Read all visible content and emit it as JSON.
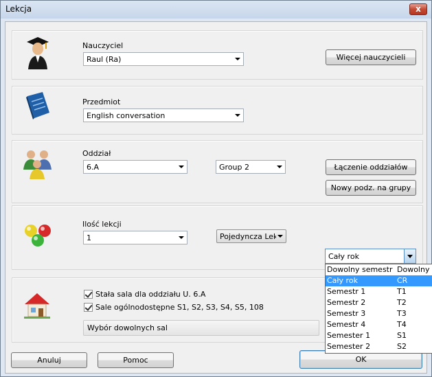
{
  "window": {
    "title": "Lekcja",
    "close": "x"
  },
  "teacher": {
    "label": "Nauczyciel",
    "value": "Raul (Ra)",
    "more_button": "Więcej nauczycieli"
  },
  "subject": {
    "label": "Przedmiot",
    "value": "English conversation"
  },
  "class": {
    "label": "Oddział",
    "value": "6.A",
    "group": "Group 2",
    "join_button": "Łączenie oddziałów",
    "split_button": "Nowy podz. na grupy"
  },
  "lessons": {
    "label": "Ilość lekcji",
    "count": "1",
    "type": "Pojedyncza Lekc",
    "period_value": "Cały rok"
  },
  "period_list": [
    {
      "name": "Dowolny semestr",
      "code": "Dowolny"
    },
    {
      "name": "Cały rok",
      "code": "CR"
    },
    {
      "name": "Semestr 1",
      "code": "T1"
    },
    {
      "name": "Semestr 2",
      "code": "T2"
    },
    {
      "name": "Semestr 3",
      "code": "T3"
    },
    {
      "name": "Semestr 4",
      "code": "T4"
    },
    {
      "name": "Semester 1",
      "code": "S1"
    },
    {
      "name": "Semester 2",
      "code": "S2"
    }
  ],
  "rooms": {
    "fixed_room": "Stała sala dla oddziału U. 6.A",
    "shared_rooms": "Sale ogólnodostępne S1, S2, S3, S4, S5, 108",
    "choose_button": "Wybór dowolnych sal"
  },
  "footer": {
    "cancel": "Anuluj",
    "help": "Pomoc",
    "ok": "OK"
  },
  "colors": {
    "selection": "#3399ff",
    "title_bg": "#dbe6f3",
    "close": "#c64a35"
  }
}
